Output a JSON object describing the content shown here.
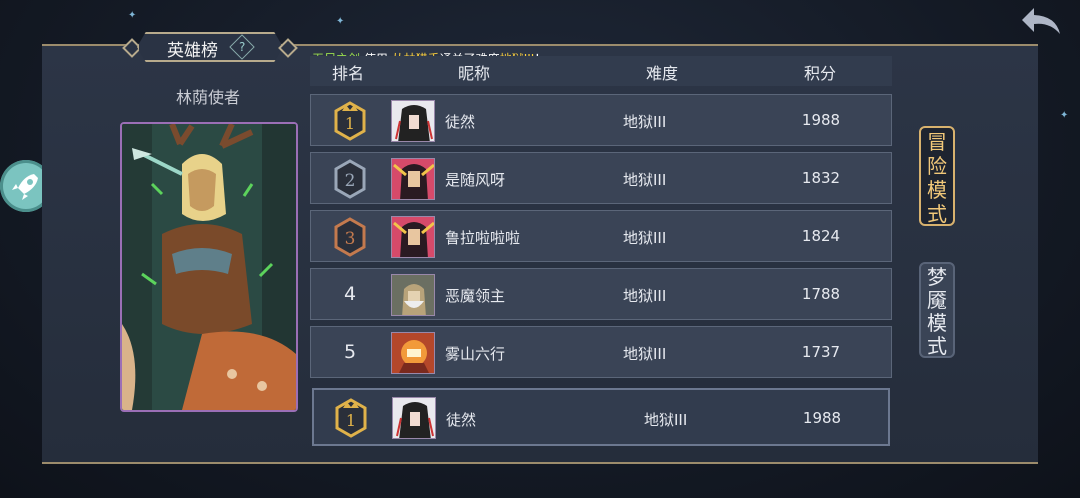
{
  "title": "英雄榜",
  "help_icon": "?",
  "hero_name": "林荫使者",
  "announcement": {
    "player": "无尽之剑",
    "text1": " 使用 ",
    "hero": "丛林猎手",
    "text2": "通关了难度",
    "difficulty": "地狱III",
    "text3": "！"
  },
  "headers": {
    "rank": "排名",
    "nickname": "昵称",
    "difficulty": "难度",
    "score": "积分"
  },
  "rows": [
    {
      "rank": "1",
      "nickname": "徒然",
      "difficulty": "地狱III",
      "score": "1988"
    },
    {
      "rank": "2",
      "nickname": "是随风呀",
      "difficulty": "地狱III",
      "score": "1832"
    },
    {
      "rank": "3",
      "nickname": "鲁拉啦啦啦",
      "difficulty": "地狱III",
      "score": "1824"
    },
    {
      "rank": "4",
      "nickname": "恶魔领主",
      "difficulty": "地狱III",
      "score": "1788"
    },
    {
      "rank": "5",
      "nickname": "雾山六行",
      "difficulty": "地狱III",
      "score": "1737"
    }
  ],
  "my_row": {
    "rank": "1",
    "nickname": "徒然",
    "difficulty": "地狱III",
    "score": "1988"
  },
  "modes": {
    "adventure": "冒险模式",
    "nightmare": "梦魇模式"
  },
  "colors": {
    "gold": "#e0b24a",
    "silver": "#9aa7b8",
    "bronze": "#c47a4e",
    "accent": "#f1c879"
  },
  "icons": {
    "back": "back-arrow-icon",
    "rocket": "rocket-icon",
    "help": "help-icon"
  }
}
